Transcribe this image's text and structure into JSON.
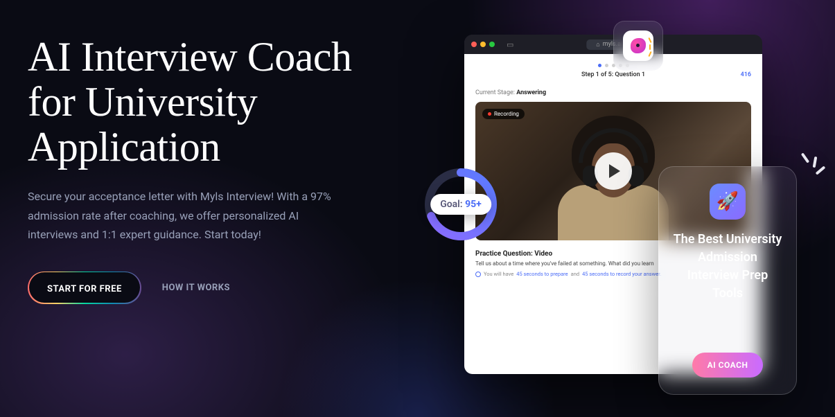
{
  "hero": {
    "headline": "AI Interview Coach for University Application",
    "subtext": "Secure your acceptance letter with Myls Interview! With a 97% admission rate after coaching, we offer personalized AI interviews and 1:1 expert guidance. Start today!",
    "primary_cta": "START FOR FREE",
    "secondary_cta": "HOW IT WORKS"
  },
  "browser": {
    "url": "myls.ai",
    "step_label": "Step 1 of 5: Question 1",
    "step_count": "416",
    "stage_label": "Current Stage:",
    "stage_value": "Answering",
    "recording_label": "Recording",
    "pq_title": "Practice Question: Video",
    "pq_text": "Tell us about a time where you've failed at something. What did you learn",
    "hint_pre": "You will have",
    "hint_a": "45 seconds to prepare",
    "hint_mid": "and",
    "hint_b": "45 seconds to record your answer."
  },
  "goal": {
    "label": "Goal:",
    "value": "95+"
  },
  "promo": {
    "title": "The Best University Admission Interview Prep Tools",
    "cta": "AI COACH"
  }
}
